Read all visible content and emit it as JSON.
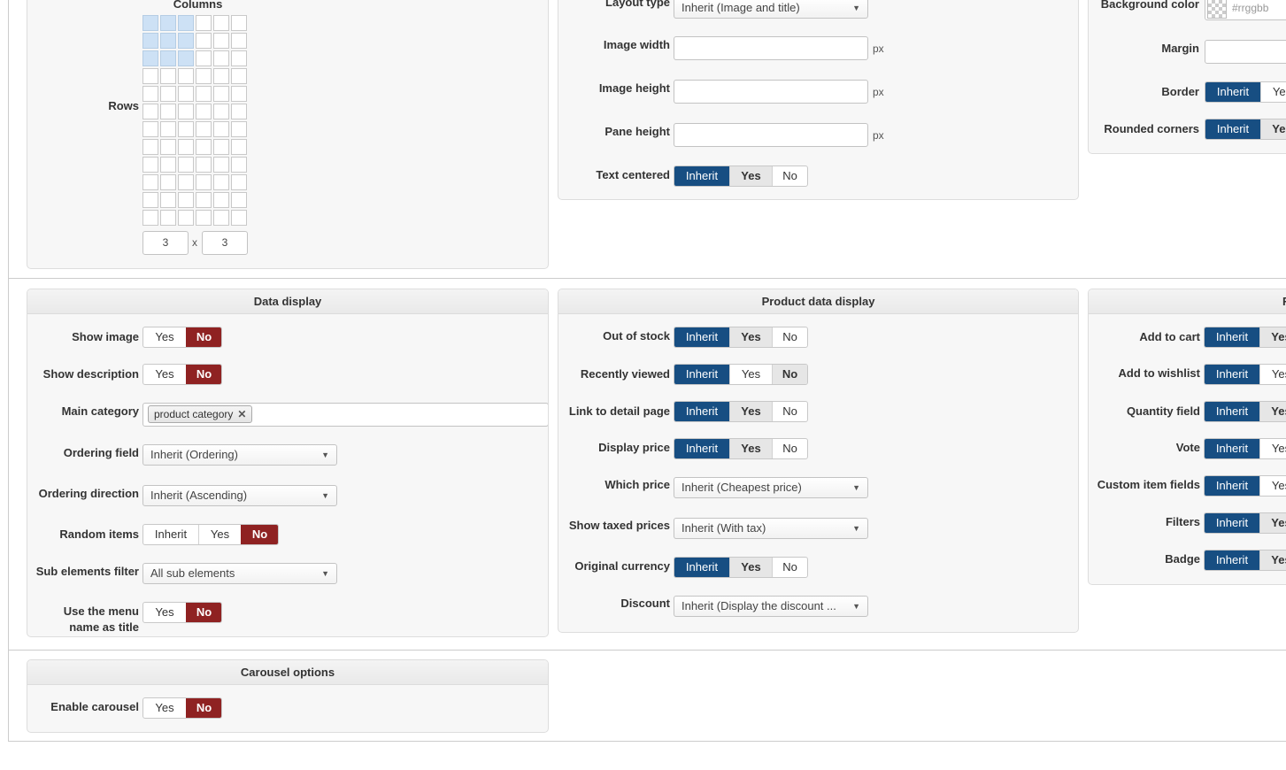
{
  "top": {
    "grid": {
      "columns_label": "Columns",
      "rows_label": "Rows",
      "cols_value": "3",
      "times": "x",
      "rows_value": "3"
    },
    "layout": {
      "layout_type_label": "Layout type",
      "layout_type_value": "Inherit (Image and title)",
      "image_width_label": "Image width",
      "image_height_label": "Image height",
      "pane_height_label": "Pane height",
      "unit": "px",
      "text_centered_label": "Text centered",
      "text_centered_options": [
        "Inherit",
        "Yes",
        "No"
      ]
    },
    "style": {
      "background_color_label": "Background color",
      "background_color_placeholder": "#rrggbb",
      "margin_label": "Margin",
      "border_label": "Border",
      "border_options": [
        "Inherit",
        "Yes"
      ],
      "rounded_label": "Rounded corners",
      "rounded_options": [
        "Inherit",
        "Yes"
      ]
    }
  },
  "data_display": {
    "title": "Data display",
    "show_image_label": "Show image",
    "show_description_label": "Show description",
    "yes": "Yes",
    "no": "No",
    "inherit": "Inherit",
    "main_category_label": "Main category",
    "main_category_chip": "product category",
    "ordering_field_label": "Ordering field",
    "ordering_field_value": "Inherit (Ordering)",
    "ordering_direction_label": "Ordering direction",
    "ordering_direction_value": "Inherit (Ascending)",
    "random_items_label": "Random items",
    "sub_elements_label": "Sub elements filter",
    "sub_elements_value": "All sub elements",
    "menu_name_label": "Use the menu name as title"
  },
  "product_data": {
    "title": "Product data display",
    "out_of_stock_label": "Out of stock",
    "recently_viewed_label": "Recently viewed",
    "link_detail_label": "Link to detail page",
    "display_price_label": "Display price",
    "which_price_label": "Which price",
    "which_price_value": "Inherit (Cheapest price)",
    "taxed_label": "Show taxed prices",
    "taxed_value": "Inherit (With tax)",
    "original_currency_label": "Original currency",
    "discount_label": "Discount",
    "discount_value": "Inherit (Display the discount ...",
    "options": [
      "Inherit",
      "Yes",
      "No"
    ]
  },
  "right_panel": {
    "title_fragment": "F",
    "add_to_cart_label": "Add to cart",
    "add_to_wishlist_label": "Add to wishlist",
    "quantity_label": "Quantity field",
    "vote_label": "Vote",
    "custom_fields_label": "Custom item fields",
    "filters_label": "Filters",
    "badge_label": "Badge",
    "inherit": "Inherit",
    "yes_partial": "Yes"
  },
  "carousel": {
    "title": "Carousel options",
    "enable_label": "Enable carousel",
    "yes": "Yes",
    "no": "No"
  },
  "colors": {
    "inherit_active": "#174e82",
    "no_active": "#8f2222",
    "grid_selected": "#cde1f5"
  }
}
